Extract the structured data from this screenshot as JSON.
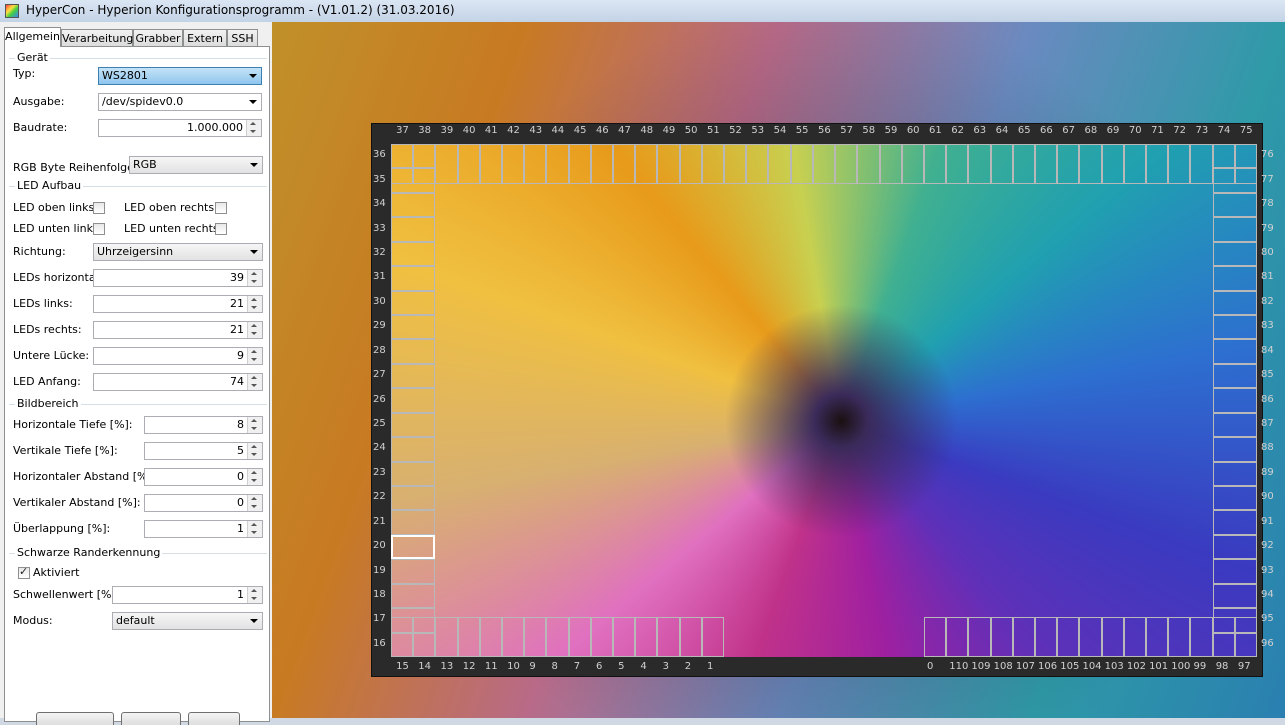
{
  "window": {
    "title": "HyperCon - Hyperion Konfigurationsprogramm - (V1.01.2) (31.03.2016)"
  },
  "tabs": [
    {
      "label": "Allgemein",
      "active": true
    },
    {
      "label": "Verarbeitung",
      "active": false
    },
    {
      "label": "Grabber",
      "active": false
    },
    {
      "label": "Extern",
      "active": false
    },
    {
      "label": "SSH",
      "active": false
    }
  ],
  "geraet": {
    "group_title": "Gerät",
    "typ_label": "Typ:",
    "typ_value": "WS2801",
    "ausgabe_label": "Ausgabe:",
    "ausgabe_value": "/dev/spidev0.0",
    "baudrate_label": "Baudrate:",
    "baudrate_value": "1.000.000",
    "rgb_label": "RGB Byte Reihenfolge:",
    "rgb_value": "RGB"
  },
  "led_aufbau": {
    "group_title": "LED Aufbau",
    "oben_links": "LED oben links:",
    "oben_rechts": "LED oben rechts:",
    "unten_links": "LED unten links:",
    "unten_rechts": "LED unten rechts:",
    "richtung_label": "Richtung:",
    "richtung_value": "Uhrzeigersinn",
    "horizontal_label": "LEDs horizontal:",
    "horizontal_value": "39",
    "links_label": "LEDs links:",
    "links_value": "21",
    "rechts_label": "LEDs rechts:",
    "rechts_value": "21",
    "luecke_label": "Untere Lücke:",
    "luecke_value": "9",
    "anfang_label": "LED Anfang:",
    "anfang_value": "74"
  },
  "bildbereich": {
    "group_title": "Bildbereich",
    "h_tiefe_label": "Horizontale Tiefe [%]:",
    "h_tiefe_value": "8",
    "v_tiefe_label": "Vertikale Tiefe [%]:",
    "v_tiefe_value": "5",
    "h_abstand_label": "Horizontaler Abstand [%]:",
    "h_abstand_value": "0",
    "v_abstand_label": "Vertikaler Abstand [%]:",
    "v_abstand_value": "0",
    "ueberlappung_label": "Überlappung [%]:",
    "ueberlappung_value": "1"
  },
  "schwarz": {
    "group_title": "Schwarze Randerkennung",
    "aktiviert_label": "Aktiviert",
    "schwelle_label": "Schwellenwert [%]:",
    "schwelle_value": "1",
    "modus_label": "Modus:",
    "modus_value": "default"
  },
  "led_numbers": {
    "top": [
      "37",
      "38",
      "39",
      "40",
      "41",
      "42",
      "43",
      "44",
      "45",
      "46",
      "47",
      "48",
      "49",
      "50",
      "51",
      "52",
      "53",
      "54",
      "55",
      "56",
      "57",
      "58",
      "59",
      "60",
      "61",
      "62",
      "63",
      "64",
      "65",
      "66",
      "67",
      "68",
      "69",
      "70",
      "71",
      "72",
      "73",
      "74",
      "75"
    ],
    "left": [
      "36",
      "35",
      "34",
      "33",
      "32",
      "31",
      "30",
      "29",
      "28",
      "27",
      "26",
      "25",
      "24",
      "23",
      "22",
      "21",
      "20",
      "19",
      "18",
      "17",
      "16"
    ],
    "right": [
      "76",
      "77",
      "78",
      "79",
      "80",
      "81",
      "82",
      "83",
      "84",
      "85",
      "86",
      "87",
      "88",
      "89",
      "90",
      "91",
      "92",
      "93",
      "94",
      "95",
      "96"
    ],
    "bottom_left": [
      "15",
      "14",
      "13",
      "12",
      "11",
      "10",
      "9",
      "8",
      "7",
      "6",
      "5",
      "4",
      "3",
      "2",
      "1"
    ],
    "bottom_right": [
      "0",
      "110",
      "109",
      "108",
      "107",
      "106",
      "105",
      "104",
      "103",
      "102",
      "101",
      "100",
      "99",
      "98",
      "97"
    ]
  },
  "colors": {
    "accent": "#3c7fb1",
    "led_outline": "#b8b8b8",
    "led_highlight": "#ffffff"
  }
}
